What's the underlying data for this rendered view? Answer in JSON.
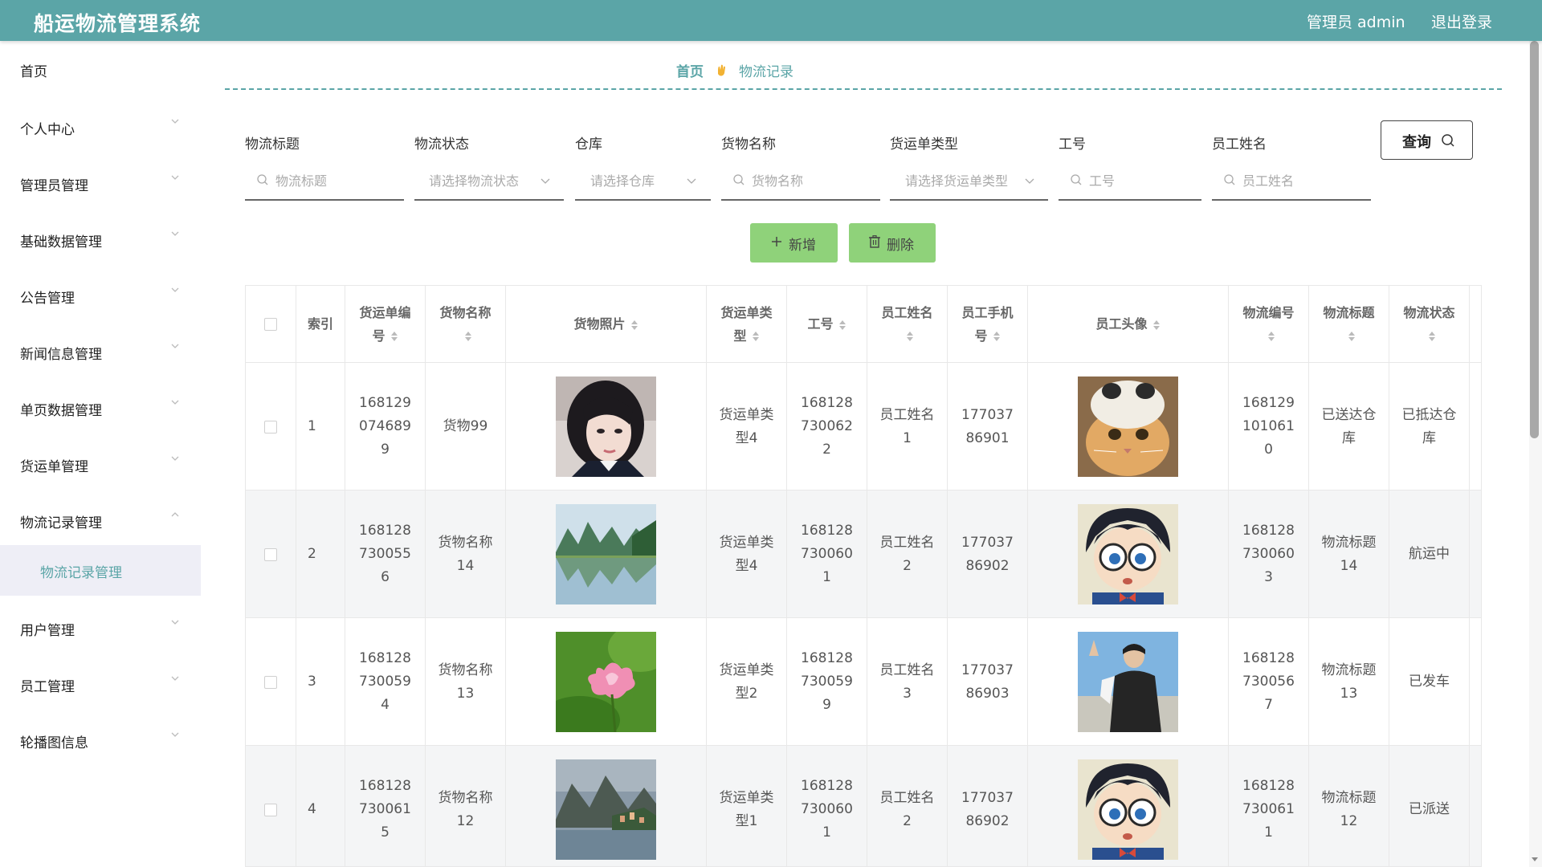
{
  "header": {
    "app_title": "船运物流管理系统",
    "admin_label": "管理员 admin",
    "logout": "退出登录"
  },
  "sidebar": {
    "items": [
      {
        "label": "首页"
      },
      {
        "label": "个人中心"
      },
      {
        "label": "管理员管理"
      },
      {
        "label": "基础数据管理"
      },
      {
        "label": "公告管理"
      },
      {
        "label": "新闻信息管理"
      },
      {
        "label": "单页数据管理"
      },
      {
        "label": "货运单管理"
      },
      {
        "label": "物流记录管理"
      },
      {
        "label": "用户管理"
      },
      {
        "label": "员工管理"
      },
      {
        "label": "轮播图信息"
      }
    ],
    "active_sub": "物流记录管理"
  },
  "breadcrumb": {
    "home": "首页",
    "current": "物流记录"
  },
  "filters": [
    {
      "label": "物流标题",
      "placeholder": "物流标题"
    },
    {
      "label": "物流状态",
      "placeholder": "请选择物流状态"
    },
    {
      "label": "仓库",
      "placeholder": "请选择仓库"
    },
    {
      "label": "货物名称",
      "placeholder": "货物名称"
    },
    {
      "label": "货运单类型",
      "placeholder": "请选择货运单类型"
    },
    {
      "label": "工号",
      "placeholder": "工号"
    },
    {
      "label": "员工姓名",
      "placeholder": "员工姓名"
    }
  ],
  "buttons": {
    "query": "查询",
    "add": "新增",
    "delete": "删除"
  },
  "table": {
    "headers": [
      "索引",
      "货运单编号",
      "货物名称",
      "货物照片",
      "货运单类型",
      "工号",
      "员工姓名",
      "员工手机号",
      "员工头像",
      "物流编号",
      "物流标题",
      "物流状态"
    ],
    "rows": [
      {
        "index": "1",
        "order_no": "1681290746899",
        "goods": "货物99",
        "photo": "portrait",
        "order_type": "货运单类型4",
        "job_no": "1681287300622",
        "emp_name": "员工姓名1",
        "phone": "17703786901",
        "avatar": "cat",
        "logistics_no": "1681291010610",
        "title": "已送达仓库",
        "status": "已抵达仓库"
      },
      {
        "index": "2",
        "order_no": "1681287300556",
        "goods": "货物名称14",
        "photo": "lake-mountains",
        "order_type": "货运单类型4",
        "job_no": "1681287300601",
        "emp_name": "员工姓名2",
        "phone": "17703786902",
        "avatar": "cartoon",
        "logistics_no": "1681287300603",
        "title": "物流标题14",
        "status": "航运中"
      },
      {
        "index": "3",
        "order_no": "1681287300594",
        "goods": "货物名称13",
        "photo": "lotus",
        "order_type": "货运单类型2",
        "job_no": "1681287300599",
        "emp_name": "员工姓名3",
        "phone": "17703786903",
        "avatar": "person",
        "logistics_no": "1681287300567",
        "title": "物流标题13",
        "status": "已发车"
      },
      {
        "index": "4",
        "order_no": "1681287300615",
        "goods": "货物名称12",
        "photo": "village",
        "order_type": "货运单类型1",
        "job_no": "1681287300601",
        "emp_name": "员工姓名2",
        "phone": "17703786902",
        "avatar": "cartoon",
        "logistics_no": "1681287300611",
        "title": "物流标题12",
        "status": "已派送"
      }
    ]
  },
  "colors": {
    "primary": "#5ba5a7",
    "button_green": "#8fd27a",
    "active_bg": "#eeeef6"
  }
}
